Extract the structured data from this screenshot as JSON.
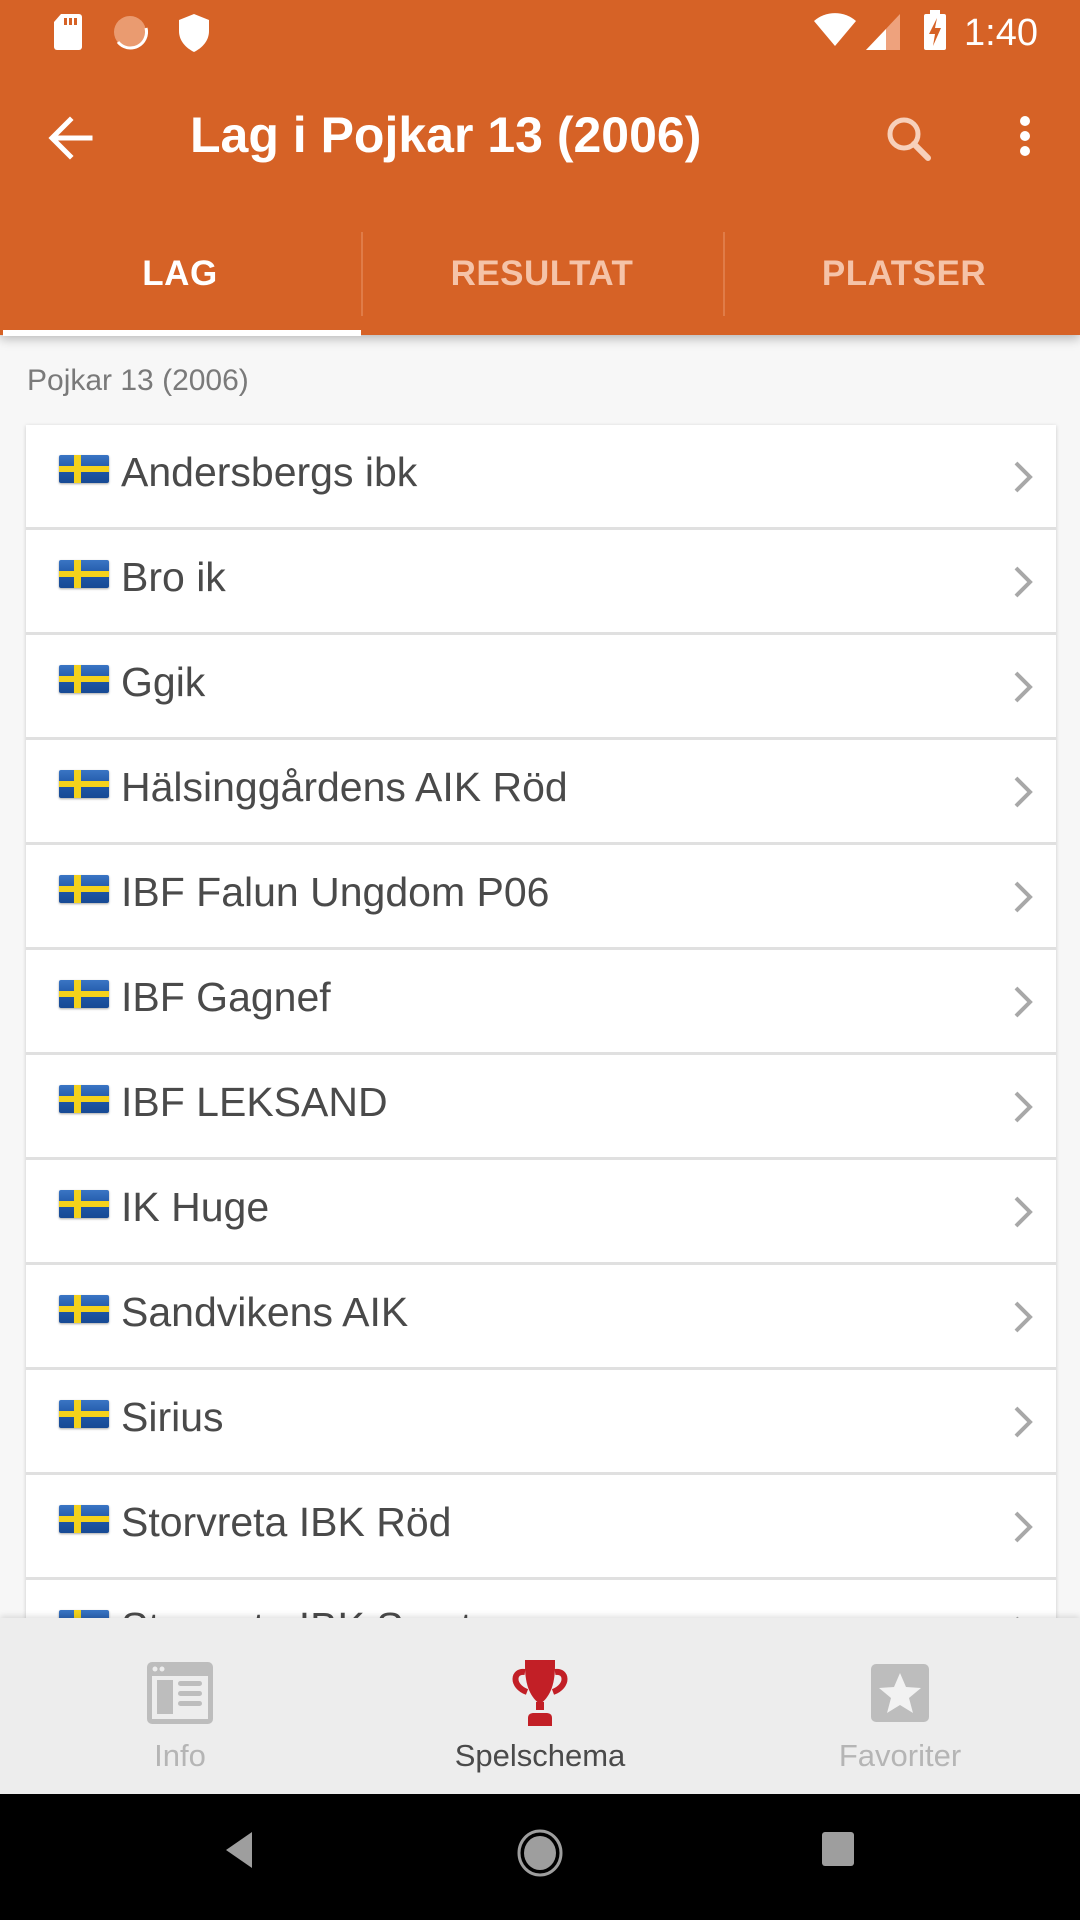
{
  "status_bar": {
    "time": "1:40",
    "left_icons": [
      "sd-card-icon",
      "sync-icon",
      "shield-icon"
    ],
    "right_icons": [
      "wifi-icon",
      "cell-signal-icon",
      "battery-charging-icon"
    ]
  },
  "toolbar": {
    "title": "Lag i Pojkar 13 (2006)",
    "back_icon": "arrow-back-icon",
    "search_icon": "search-icon",
    "more_icon": "more-vert-icon"
  },
  "tabs": [
    {
      "label": "LAG",
      "active": true
    },
    {
      "label": "RESULTAT",
      "active": false
    },
    {
      "label": "PLATSER",
      "active": false
    }
  ],
  "section": {
    "label": "Pojkar 13 (2006)"
  },
  "teams": [
    {
      "name": "Andersbergs ibk",
      "flag": "sweden-flag-icon"
    },
    {
      "name": "Bro ik",
      "flag": "sweden-flag-icon"
    },
    {
      "name": "Ggik",
      "flag": "sweden-flag-icon"
    },
    {
      "name": "Hälsinggårdens AIK Röd",
      "flag": "sweden-flag-icon"
    },
    {
      "name": "IBF Falun Ungdom P06",
      "flag": "sweden-flag-icon"
    },
    {
      "name": "IBF Gagnef",
      "flag": "sweden-flag-icon"
    },
    {
      "name": "IBF LEKSAND",
      "flag": "sweden-flag-icon"
    },
    {
      "name": "IK Huge",
      "flag": "sweden-flag-icon"
    },
    {
      "name": "Sandvikens AIK",
      "flag": "sweden-flag-icon"
    },
    {
      "name": "Sirius",
      "flag": "sweden-flag-icon"
    },
    {
      "name": "Storvreta IBK Röd",
      "flag": "sweden-flag-icon"
    },
    {
      "name": "Storvreta IBK Svart",
      "flag": "sweden-flag-icon"
    }
  ],
  "bottom_nav": [
    {
      "label": "Info",
      "icon": "newspaper-icon",
      "active": false
    },
    {
      "label": "Spelschema",
      "icon": "trophy-icon",
      "active": true
    },
    {
      "label": "Favoriter",
      "icon": "star-icon",
      "active": false
    }
  ],
  "colors": {
    "primary": "#d66226",
    "active_nav_icon": "#c21f26",
    "inactive_nav": "#b5b5b5",
    "text": "#4a4a4a"
  }
}
